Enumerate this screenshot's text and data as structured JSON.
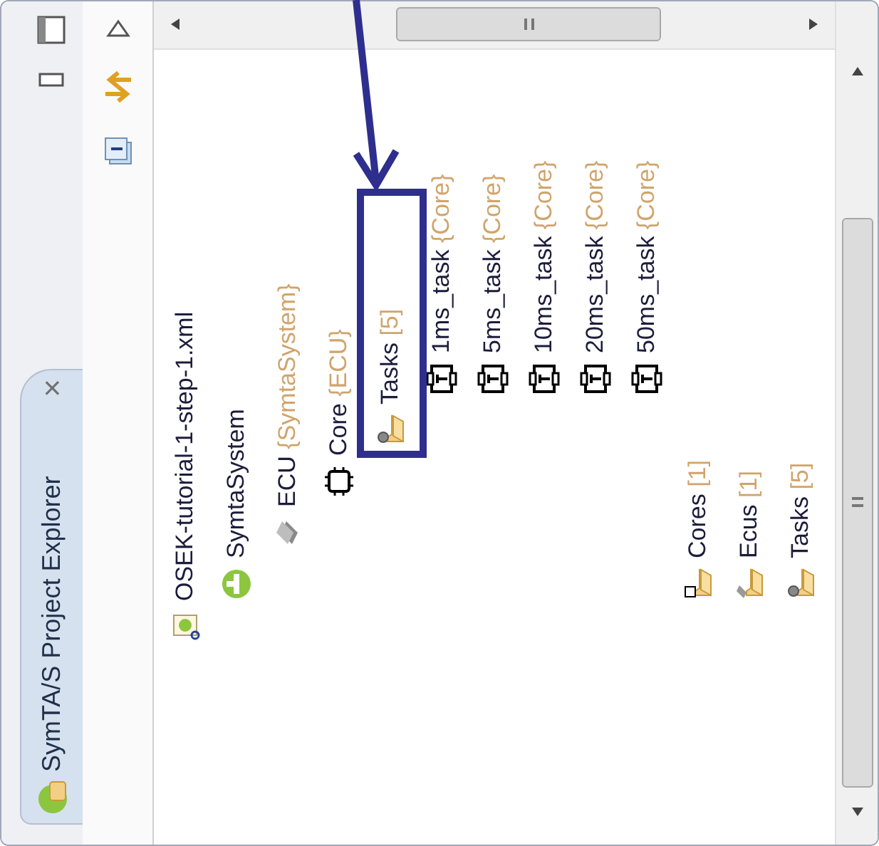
{
  "view": {
    "title": "SymTA/S Project Explorer",
    "close": "×"
  },
  "tree": [
    {
      "label": "OSEK-tutorial-1-step-1.xml",
      "kind": "file",
      "children": [
        {
          "label": "SymtaSystem",
          "kind": "system",
          "children": [
            {
              "label": "ECU",
              "suffix": "{SymtaSystem}",
              "kind": "ecu",
              "children": [
                {
                  "label": "Core",
                  "suffix": "{ECU}",
                  "kind": "core",
                  "children": [
                    {
                      "label": "Tasks",
                      "suffix": "[5]",
                      "kind": "taskfolder",
                      "children": [
                        {
                          "label": "1ms_task",
                          "suffix": "{Core}",
                          "kind": "task"
                        },
                        {
                          "label": "5ms_task",
                          "suffix": "{Core}",
                          "kind": "task"
                        },
                        {
                          "label": "10ms_task",
                          "suffix": "{Core}",
                          "kind": "task"
                        },
                        {
                          "label": "20ms_task",
                          "suffix": "{Core}",
                          "kind": "task"
                        },
                        {
                          "label": "50ms_task",
                          "suffix": "{Core}",
                          "kind": "task"
                        }
                      ]
                    }
                  ]
                }
              ]
            }
          ]
        },
        {
          "label": "Cores",
          "suffix": "[1]",
          "kind": "corefolder"
        },
        {
          "label": "Ecus",
          "suffix": "[1]",
          "kind": "ecufolder"
        },
        {
          "label": "Tasks",
          "suffix": "[5]",
          "kind": "taskfolder"
        }
      ]
    }
  ]
}
